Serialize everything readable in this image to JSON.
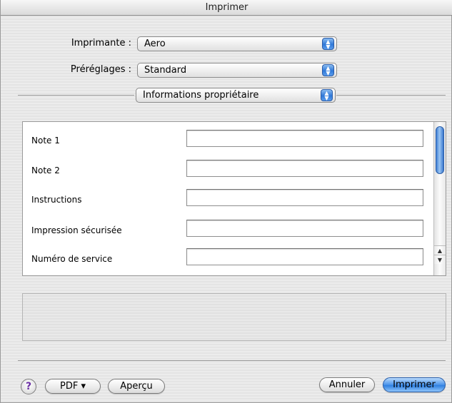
{
  "window": {
    "title": "Imprimer"
  },
  "printer": {
    "label": "Imprimante :",
    "value": "Aero"
  },
  "presets": {
    "label": "Préréglages :",
    "value": "Standard"
  },
  "section": {
    "value": "Informations propriétaire"
  },
  "fields": [
    {
      "label": "Note 1",
      "value": ""
    },
    {
      "label": "Note 2",
      "value": ""
    },
    {
      "label": "Instructions",
      "value": ""
    },
    {
      "label": "Impression sécurisée",
      "value": ""
    },
    {
      "label": "Numéro de service",
      "value": ""
    }
  ],
  "buttons": {
    "help": "?",
    "pdf": "PDF ▾",
    "preview": "Aperçu",
    "cancel": "Annuler",
    "print": "Imprimer"
  },
  "icons": {
    "popup_arrows": "updown-arrows-icon",
    "help": "help-icon",
    "scroll_up": "scroll-up-arrow-icon",
    "scroll_down": "scroll-down-arrow-icon"
  },
  "colors": {
    "accent": "#2f7fe0",
    "help_glyph": "#6b2fa6"
  }
}
